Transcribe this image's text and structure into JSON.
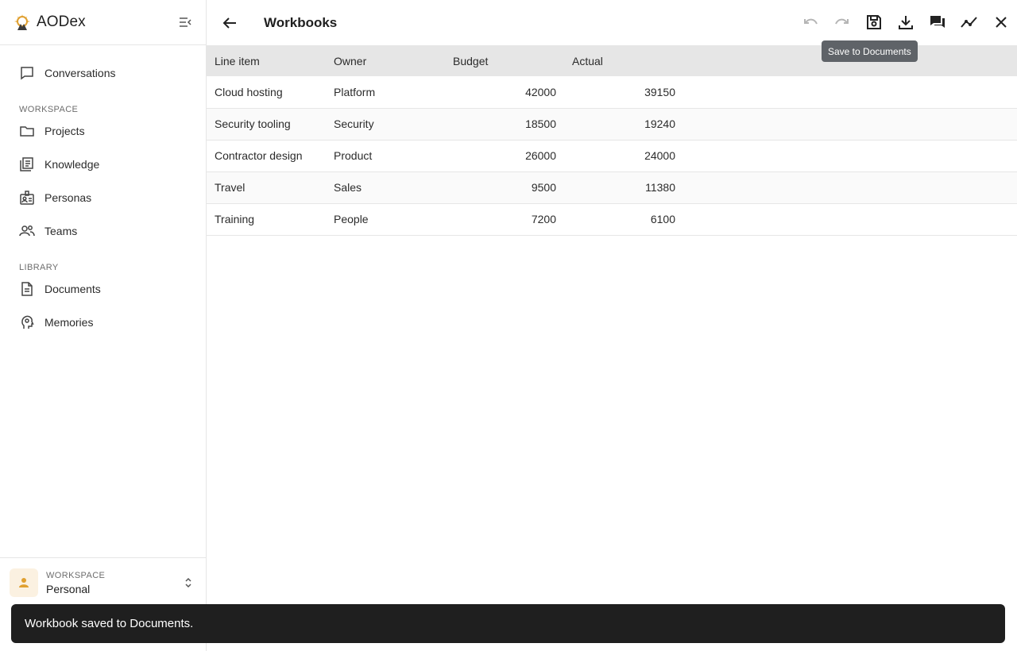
{
  "app": {
    "name": "AODex"
  },
  "sidebar": {
    "top_items": [
      {
        "label": "Conversations",
        "icon": "chat-bubble-icon"
      }
    ],
    "workspace_section": {
      "label": "WORKSPACE",
      "items": [
        {
          "label": "Projects",
          "icon": "folder-icon"
        },
        {
          "label": "Knowledge",
          "icon": "library-icon"
        },
        {
          "label": "Personas",
          "icon": "badge-icon"
        },
        {
          "label": "Teams",
          "icon": "people-icon"
        }
      ]
    },
    "library_section": {
      "label": "LIBRARY",
      "items": [
        {
          "label": "Documents",
          "icon": "document-icon"
        },
        {
          "label": "Memories",
          "icon": "head-icon"
        }
      ]
    },
    "workspace_switcher": {
      "caption": "WORKSPACE",
      "name": "Personal"
    }
  },
  "header": {
    "title": "Workbooks",
    "tooltip": "Save to Documents",
    "tools": [
      "undo-icon",
      "redo-icon",
      "save-icon",
      "download-icon",
      "comments-icon",
      "chart-icon",
      "close-icon"
    ]
  },
  "table": {
    "columns": [
      "Line item",
      "Owner",
      "Budget",
      "Actual"
    ],
    "rows": [
      [
        "Cloud hosting",
        "Platform",
        "42000",
        "39150"
      ],
      [
        "Security tooling",
        "Security",
        "18500",
        "19240"
      ],
      [
        "Contractor design",
        "Product",
        "26000",
        "24000"
      ],
      [
        "Travel",
        "Sales",
        "9500",
        "11380"
      ],
      [
        "Training",
        "People",
        "7200",
        "6100"
      ]
    ]
  },
  "toast": {
    "message": "Workbook saved to Documents."
  },
  "colors": {
    "accent": "#e0a030",
    "toast_bg": "#1f1f1f",
    "header_bg": "#e6e6e6",
    "tooltip_bg": "#5f6368"
  }
}
